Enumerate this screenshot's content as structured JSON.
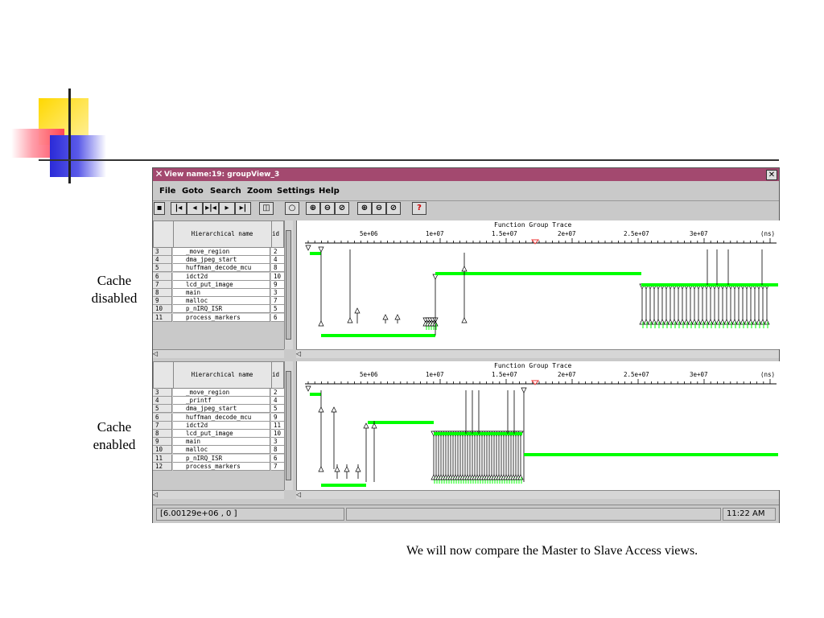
{
  "slide": {
    "label_top": "Cache disabled",
    "label_bottom": "Cache enabled",
    "caption": "We will now compare the Master to Slave Access views."
  },
  "window": {
    "title": "View name:19: groupView_3",
    "close_label": "✕",
    "menu": [
      "File",
      "Goto",
      "Search",
      "Zoom",
      "Settings",
      "Help"
    ],
    "toolbar_icons": [
      "save-icon",
      "first-icon",
      "prev-icon",
      "center-icon",
      "next-icon",
      "last-icon",
      "find-icon",
      "zoom-fit-icon",
      "zoom-in-icon",
      "zoom-out-icon",
      "zoom-range-icon",
      "zoom-y-in-icon",
      "zoom-y-out-icon",
      "zoom-y-range-icon",
      "help-icon"
    ],
    "table_header_name": "Hierarchical name",
    "table_header_id": "id",
    "trace_title": "Function Group Trace",
    "axis_ticks": [
      "5e+06",
      "1e+07",
      "1.5e+07",
      "2e+07",
      "2.5e+07",
      "3e+07"
    ],
    "axis_unit": "(ns)",
    "status_coords": "[6.00129e+06 , 0 ]",
    "status_time": "11:22 AM",
    "colors": {
      "titlebar": "#a3496f",
      "trace": "#00ff00"
    }
  },
  "pane_top": {
    "rows": [
      {
        "n": "3",
        "name": "_move_region",
        "v": "2"
      },
      {
        "n": "4",
        "name": "dma_jpeg_start",
        "v": "4"
      },
      {
        "n": "5",
        "name": "huffman_decode_mcu",
        "v": "8"
      },
      {
        "n": "6",
        "name": "idct2d",
        "v": "10"
      },
      {
        "n": "7",
        "name": "lcd_put_image",
        "v": "9"
      },
      {
        "n": "8",
        "name": "main",
        "v": "3"
      },
      {
        "n": "9",
        "name": "malloc",
        "v": "7"
      },
      {
        "n": "10",
        "name": "p_nIRQ_ISR",
        "v": "5"
      },
      {
        "n": "11",
        "name": "process_markers",
        "v": "6"
      }
    ]
  },
  "pane_bottom": {
    "rows": [
      {
        "n": "3",
        "name": "_move_region",
        "v": "2"
      },
      {
        "n": "4",
        "name": "_printf",
        "v": "4"
      },
      {
        "n": "5",
        "name": "dma_jpeg_start",
        "v": "5"
      },
      {
        "n": "6",
        "name": "huffman_decode_mcu",
        "v": "9"
      },
      {
        "n": "7",
        "name": "idct2d",
        "v": "11"
      },
      {
        "n": "8",
        "name": "lcd_put_image",
        "v": "10"
      },
      {
        "n": "9",
        "name": "main",
        "v": "3"
      },
      {
        "n": "10",
        "name": "malloc",
        "v": "8"
      },
      {
        "n": "11",
        "name": "p_nIRQ_ISR",
        "v": "6"
      },
      {
        "n": "12",
        "name": "process_markers",
        "v": "7"
      }
    ]
  }
}
